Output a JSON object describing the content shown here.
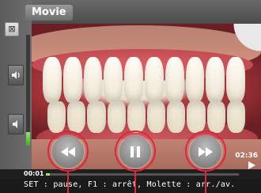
{
  "window": {
    "title": "Movie"
  },
  "sidebar": {
    "close_glyph": "⊠",
    "volume_up_icon": "speaker-loud-icon",
    "volume_down_icon": "speaker-quiet-icon",
    "volume_level": 0.12
  },
  "player": {
    "current_time": "00:01",
    "total_time": "02:36",
    "progress": 0.02,
    "controls": [
      {
        "name": "rewind",
        "icon": "rewind-icon"
      },
      {
        "name": "pause",
        "icon": "pause-icon"
      },
      {
        "name": "fast-forward",
        "icon": "fast-forward-icon"
      }
    ]
  },
  "status": {
    "help_text": "SET : pause, F1 : arrêt, Molette : arr./av."
  },
  "colors": {
    "highlight_ring": "#e2253a",
    "progress_fill": "#9ae66b",
    "header": "#555555"
  }
}
